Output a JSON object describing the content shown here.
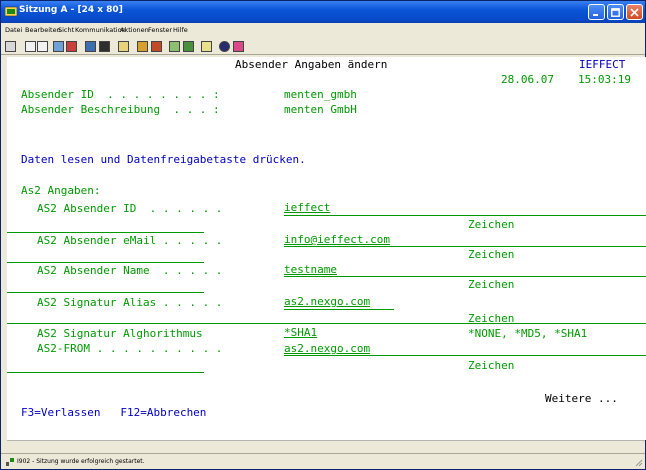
{
  "window": {
    "title": "Sitzung A - [24 x 80]"
  },
  "menu": [
    "Datei",
    "Bearbeiten",
    "Sicht",
    "Kommunikation",
    "Aktionen",
    "Fenster",
    "Hilfe"
  ],
  "screen": {
    "title": "Absender Angaben ändern",
    "program": "IEFFECT",
    "date": "28.06.07",
    "time": "15:03:19",
    "sender_id_label": "Absender ID  . . . . . . . . :",
    "sender_id_value": "menten_gmbh",
    "sender_desc_label": "Absender Beschreibung  . . . :",
    "sender_desc_value": "menten GmbH",
    "instruction": "Daten lesen und Datenfreigabetaste drücken.",
    "as2_section": "As2 Angaben:",
    "fields": [
      {
        "label": "AS2 Absender ID  . . . . . .",
        "value": "ieffect",
        "hint": "Zeichen"
      },
      {
        "label": "AS2 Absender eMail . . . . .",
        "value": "info@ieffect.com",
        "hint": "Zeichen"
      },
      {
        "label": "AS2 Absender Name  . . . . .",
        "value": "testname",
        "hint": "Zeichen"
      },
      {
        "label": "AS2 Signatur Alias . . . . .",
        "value": "as2.nexgo.com",
        "hint": "Zeichen"
      },
      {
        "label": "AS2 Signatur Alghorithmus",
        "value": "*SHA1",
        "hint": "*NONE, *MD5, *SHA1"
      },
      {
        "label": "AS2-FROM . . . . . . . . . .",
        "value": "as2.nexgo.com",
        "hint": "Zeichen"
      }
    ],
    "more": "Weitere ...",
    "fkeys": "F3=Verlassen   F12=Abbrechen"
  },
  "status": {
    "message": "I902 - Sitzung wurde erfolgreich gestartet."
  },
  "colors": {
    "field": "#009a00",
    "label": "#009a00",
    "blue": "#0000c0",
    "titlebar": "#0a55d8"
  }
}
